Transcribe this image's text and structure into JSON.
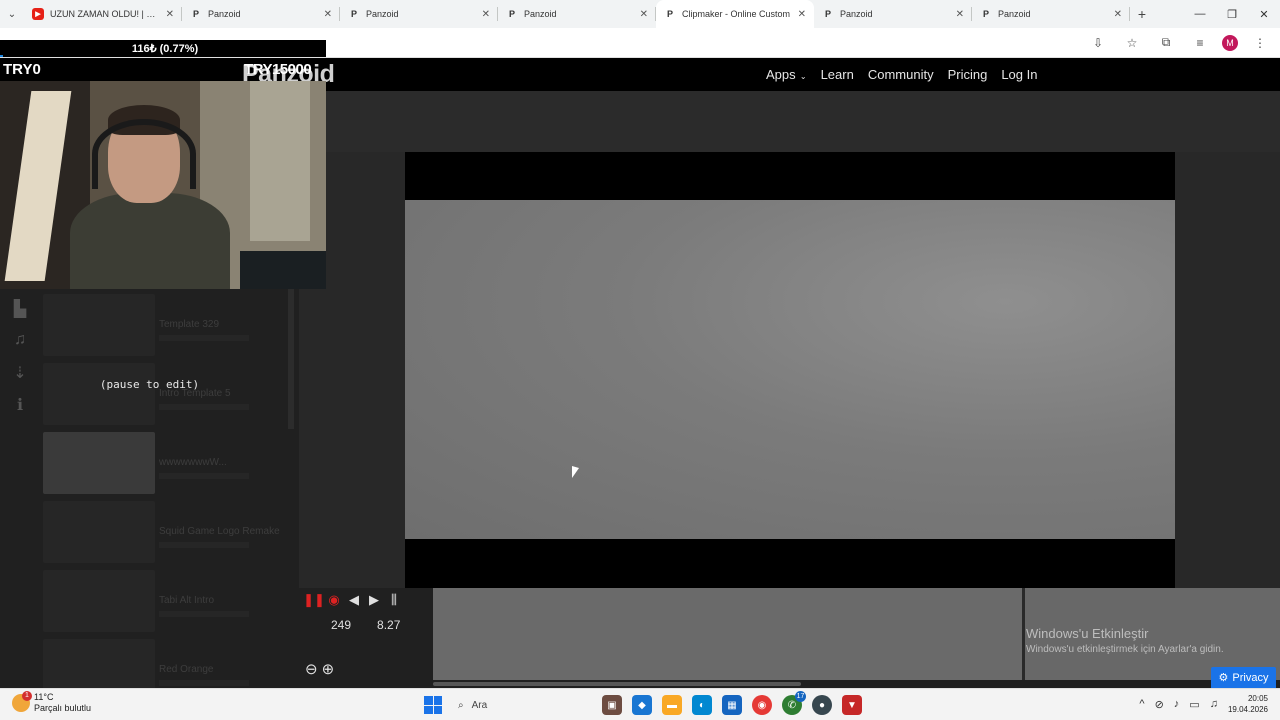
{
  "browser": {
    "tabs": [
      {
        "title": "UZUN ZAMAN OLDU! | GTA 5 R",
        "favicon": "youtube-icon",
        "active": false
      },
      {
        "title": "Panzoid",
        "favicon": "panzoid-icon",
        "active": false
      },
      {
        "title": "Panzoid",
        "favicon": "panzoid-icon",
        "active": false
      },
      {
        "title": "Panzoid",
        "favicon": "panzoid-icon",
        "active": false
      },
      {
        "title": "Clipmaker - Online Custom",
        "favicon": "panzoid-icon",
        "active": true
      },
      {
        "title": "Panzoid",
        "favicon": "panzoid-icon",
        "active": false
      },
      {
        "title": "Panzoid",
        "favicon": "panzoid-icon",
        "active": false
      }
    ],
    "profile_initial": "M"
  },
  "site": {
    "brand": "Panzoid",
    "nav": {
      "apps": "Apps",
      "learn": "Learn",
      "community": "Community",
      "pricing": "Pricing",
      "login": "Log In"
    }
  },
  "sidebar": {
    "icons": [
      "library-icon",
      "music-icon",
      "download-icon",
      "info-icon"
    ],
    "items": [
      {
        "name": "Template 329"
      },
      {
        "name": "Intro Template 5"
      },
      {
        "name": "wwwwwwwW..."
      },
      {
        "name": "Squid Game Logo Remake"
      },
      {
        "name": "Tabi Alt Intro"
      },
      {
        "name": "Red Orange"
      }
    ],
    "pause_note": "(pause to edit)"
  },
  "player": {
    "frame": "249",
    "time": "8.27"
  },
  "windows_notice": {
    "title": "Windows'u Etkinleştir",
    "subtitle": "Windows'u etkinleştirmek için Ayarlar'a gidin."
  },
  "privacy_label": "Privacy",
  "stream_overlay": {
    "progress_text": "116₺ (0.77%)",
    "progress_fraction": 0.0077,
    "left_label": "TRY0",
    "center_label": "TRY15000"
  },
  "taskbar": {
    "weather_temp": "11°C",
    "weather_desc": "Parçalı bulutlu",
    "weather_badge": "1",
    "search_label": "Ara",
    "whatsapp_badge": "17",
    "time": "20:05",
    "date": "19.04.2026"
  }
}
